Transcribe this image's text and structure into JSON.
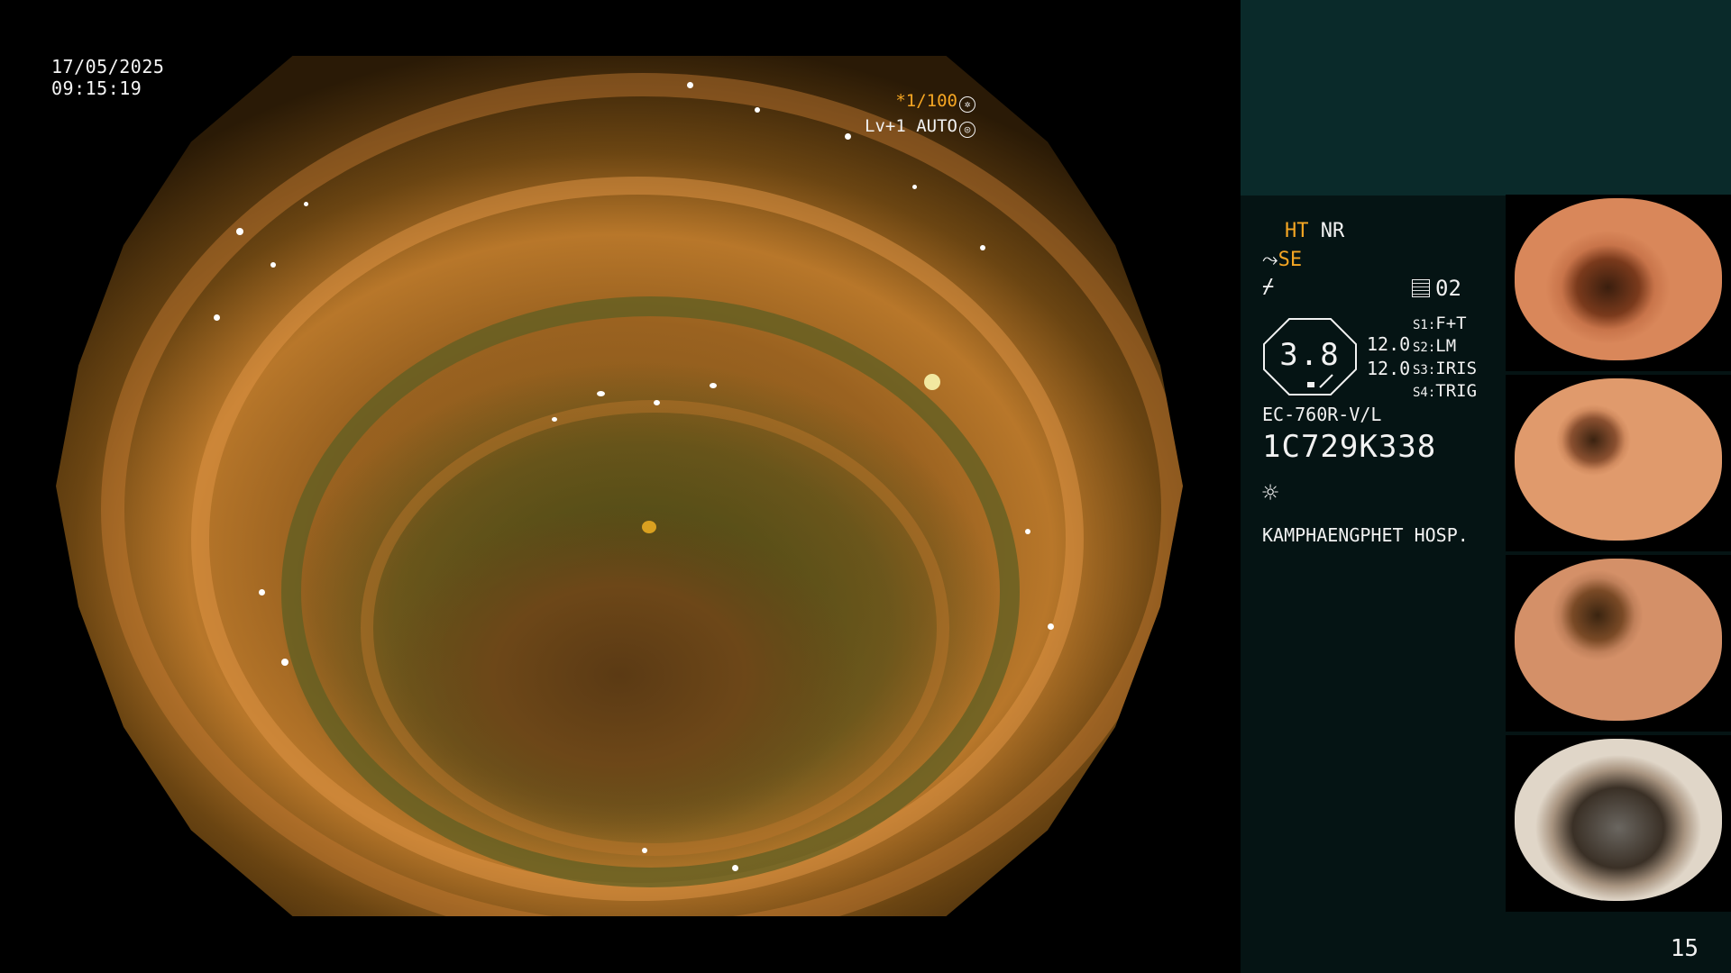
{
  "main": {
    "date": "17/05/2025",
    "time": "09:15:19",
    "shutter": "*1/100",
    "shutter_icon": "aperture-icon",
    "level": "Lv+1 AUTO",
    "level_icon": "iris-icon"
  },
  "panel": {
    "mode_ht": "HT",
    "mode_nr": "NR",
    "mode_se": "SE",
    "memo_value": "02",
    "scope_value": "3.8",
    "dial_1": "12.0",
    "dial_2": "12.0",
    "switches": [
      {
        "key": "S1:",
        "value": "F+T"
      },
      {
        "key": "S2:",
        "value": "LM"
      },
      {
        "key": "S3:",
        "value": "IRIS"
      },
      {
        "key": "S4:",
        "value": "TRIG"
      }
    ],
    "scope_model": "EC-760R-V/L",
    "serial": "1C729K338",
    "light_icon": "sun-icon",
    "hospital": "KAMPHAENGPHET HOSP.",
    "page_number": "15"
  },
  "colors": {
    "accent": "#f5a623",
    "panel_bg": "#051414",
    "panel_top_bg": "#0a2a2a"
  },
  "thumbnails": [
    {
      "label": "thumbnail-1"
    },
    {
      "label": "thumbnail-2"
    },
    {
      "label": "thumbnail-3"
    },
    {
      "label": "thumbnail-4"
    }
  ]
}
